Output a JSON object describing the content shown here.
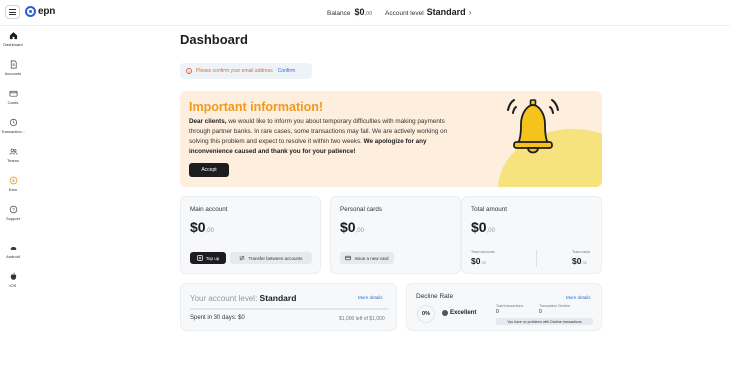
{
  "header": {
    "logo_text": "epn",
    "balance_label": "Balance",
    "balance_amount": "$0",
    "balance_cents": ",00",
    "account_level_label": "Account level",
    "account_level_value": "Standard",
    "chevron": "›"
  },
  "sidebar": {
    "items": [
      {
        "label": "Dashboard",
        "icon": "home-icon"
      },
      {
        "label": "Accounts",
        "icon": "document-icon"
      },
      {
        "label": "Cards",
        "icon": "card-icon"
      },
      {
        "label": "Transaction...",
        "icon": "history-icon"
      },
      {
        "label": "Teams",
        "icon": "team-icon"
      },
      {
        "label": "Earn",
        "icon": "coin-icon"
      },
      {
        "label": "Support",
        "icon": "help-icon"
      },
      {
        "label": "Android",
        "icon": "android-icon"
      },
      {
        "label": "iOS",
        "icon": "apple-icon"
      }
    ]
  },
  "main": {
    "title": "Dashboard",
    "email_alert": {
      "message": "Please confirm your email address",
      "action": "Confirm"
    },
    "info": {
      "title": "Important information!",
      "lead": "Dear clients,",
      "body": " we would like to inform you about temporary difficulties with making payments through partner banks. In rare cases, some transactions may fail. We are actively working on solving this problem and expect to resolve it within two weeks. ",
      "apology": "We apologize for any inconvenience caused and thank you for your patience!",
      "accept_label": "Accept"
    },
    "main_account": {
      "title": "Main account",
      "amount": "$0",
      "cents": ",00",
      "top_up_label": "Top up",
      "transfer_label": "Transfer between accounts"
    },
    "personal_cards": {
      "title": "Personal cards",
      "amount": "$0",
      "cents": ",00",
      "issue_label": "Issue a new card"
    },
    "total_amount": {
      "title": "Total amount",
      "amount": "$0",
      "cents": ",00",
      "team_accounts_label": "Team accounts",
      "team_accounts_amount": "$0",
      "team_accounts_cents": ",00",
      "team_cards_label": "Team cards",
      "team_cards_amount": "$0",
      "team_cards_cents": ",00"
    },
    "account_level": {
      "label": "Your account level:",
      "value": "Standard",
      "more_details": "More details",
      "spent": "Spent in 30 days: $0",
      "left": "$1,000 left of $1,000",
      "progress": 0
    },
    "decline_rate": {
      "title": "Decline Rate",
      "more_details": "More details",
      "percent": "0%",
      "status": "Excellent",
      "total_transactions_label": "Total transactions",
      "total_transactions_value": "0",
      "transaction_decline_label": "Transaction Decline",
      "transaction_decline_value": "0",
      "no_problems": "You have no problems with Decline transactions"
    }
  }
}
